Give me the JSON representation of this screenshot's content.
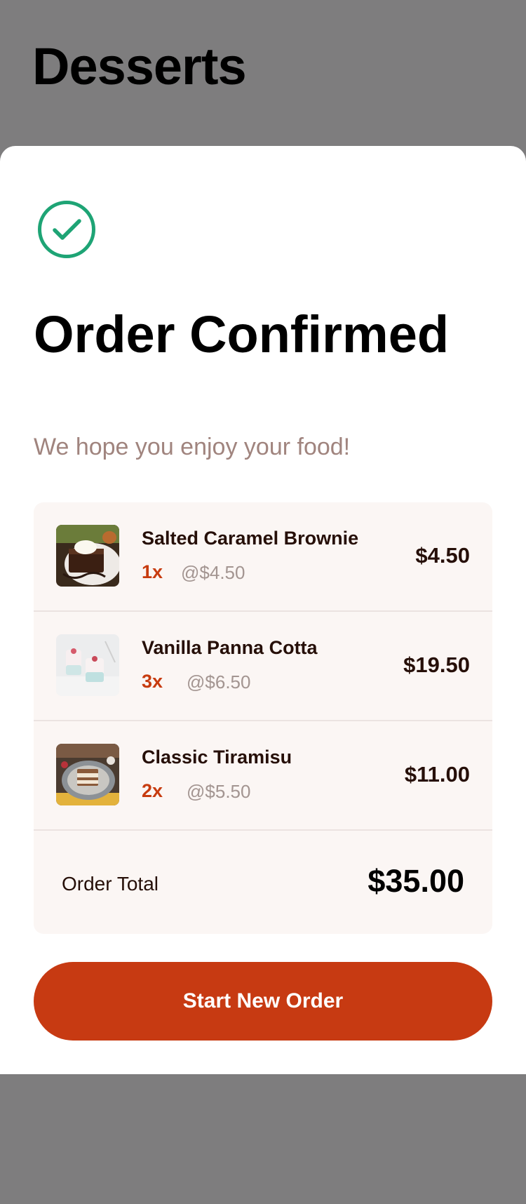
{
  "page": {
    "title": "Desserts"
  },
  "confirmation": {
    "icon": "check-circle-icon",
    "title": "Order Confirmed",
    "subtitle": "We hope you enjoy your food!"
  },
  "order": {
    "items": [
      {
        "name": "Salted Caramel Brownie",
        "quantity": "1x",
        "unit_price": "@$4.50",
        "total": "$4.50",
        "image": "brownie-image"
      },
      {
        "name": "Vanilla Panna Cotta",
        "quantity": "3x",
        "unit_price": "@$6.50",
        "total": "$19.50",
        "image": "panna-cotta-image"
      },
      {
        "name": "Classic Tiramisu",
        "quantity": "2x",
        "unit_price": "@$5.50",
        "total": "$11.00",
        "image": "tiramisu-image"
      }
    ],
    "total_label": "Order Total",
    "total_value": "$35.00"
  },
  "actions": {
    "new_order_label": "Start New Order"
  },
  "colors": {
    "accent": "#c73a12",
    "success": "#1ea475",
    "overlay": "#7e7d7e",
    "rose_text": "#a0847e"
  }
}
